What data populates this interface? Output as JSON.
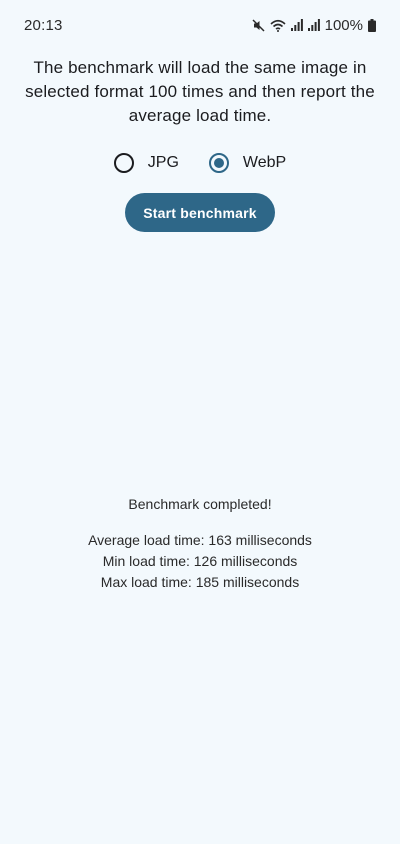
{
  "status_bar": {
    "time": "20:13",
    "battery_text": "100%"
  },
  "description": "The benchmark will load the same image in selected format 100 times and then report the average load time.",
  "format_options": [
    {
      "label": "JPG",
      "selected": false
    },
    {
      "label": "WebP",
      "selected": true
    }
  ],
  "start_button": {
    "label": "Start benchmark"
  },
  "results": {
    "status": "Benchmark completed!",
    "average": "Average load time: 163 milliseconds",
    "min": "Min load time: 126 milliseconds",
    "max": "Max load time: 185 milliseconds"
  },
  "colors": {
    "background": "#f3f9fd",
    "accent": "#2e6788",
    "text": "#1b1c1f"
  },
  "icons": [
    "mute-icon",
    "wifi-icon",
    "signal-icon",
    "signal-r-icon",
    "battery-icon"
  ]
}
